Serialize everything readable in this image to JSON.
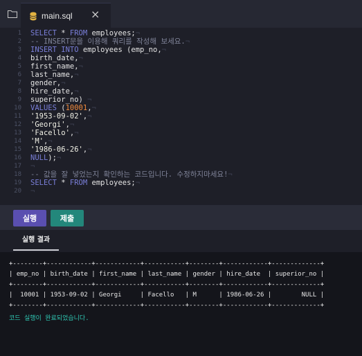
{
  "tab": {
    "filename": "main.sql",
    "close_glyph": "×"
  },
  "icons": {
    "folder": "folder-icon",
    "file": "database-icon",
    "close": "close-icon"
  },
  "editor": {
    "line_numbers": [
      "1",
      "2",
      "3",
      "4",
      "5",
      "6",
      "7",
      "8",
      "9",
      "10",
      "11",
      "12",
      "13",
      "14",
      "15",
      "16",
      "17",
      "18",
      "19",
      "20"
    ],
    "lines": [
      [
        [
          "kw",
          "SELECT"
        ],
        [
          "t",
          " * "
        ],
        [
          "kw",
          "FROM"
        ],
        [
          "t",
          " employees;"
        ],
        [
          "ws",
          "¬"
        ]
      ],
      [
        [
          "cmt",
          "-- INSERT문을 이용해 쿼리를 작성해 보세요."
        ],
        [
          "ws",
          "¬"
        ]
      ],
      [
        [
          "kw",
          "INSERT INTO"
        ],
        [
          "t",
          " employees (emp_no,"
        ],
        [
          "ws",
          "¬"
        ]
      ],
      [
        [
          "t",
          "birth_date,"
        ],
        [
          "ws",
          "¬"
        ]
      ],
      [
        [
          "t",
          "first_name,"
        ],
        [
          "ws",
          "¬"
        ]
      ],
      [
        [
          "t",
          "last_name,"
        ],
        [
          "ws",
          "¬"
        ]
      ],
      [
        [
          "t",
          "gender,"
        ],
        [
          "ws",
          "¬"
        ]
      ],
      [
        [
          "t",
          "hire_date,"
        ],
        [
          "ws",
          "¬"
        ]
      ],
      [
        [
          "t",
          "superior_no)"
        ],
        [
          "ws",
          " ¬"
        ]
      ],
      [
        [
          "kw",
          "VALUES"
        ],
        [
          "t",
          " ("
        ],
        [
          "num",
          "10001"
        ],
        [
          "t",
          ","
        ],
        [
          "ws",
          "¬"
        ]
      ],
      [
        [
          "str",
          "'1953-09-02'"
        ],
        [
          "t",
          ","
        ],
        [
          "ws",
          "¬"
        ]
      ],
      [
        [
          "str",
          "'Georgi'"
        ],
        [
          "t",
          ","
        ],
        [
          "ws",
          "¬"
        ]
      ],
      [
        [
          "str",
          "'Facello'"
        ],
        [
          "t",
          ","
        ],
        [
          "ws",
          "¬"
        ]
      ],
      [
        [
          "str",
          "'M'"
        ],
        [
          "t",
          ","
        ],
        [
          "ws",
          "¬"
        ]
      ],
      [
        [
          "str",
          "'1986-06-26'"
        ],
        [
          "t",
          ","
        ],
        [
          "ws",
          "¬"
        ]
      ],
      [
        [
          "kw",
          "NULL"
        ],
        [
          "t",
          ");"
        ],
        [
          "ws",
          "¬"
        ]
      ],
      [
        [
          "ws",
          "¬"
        ]
      ],
      [
        [
          "cmt",
          "-- 값을 잘 넣었는지 확인하는 코드입니다. 수정하지마세요!"
        ],
        [
          "ws",
          "¬"
        ]
      ],
      [
        [
          "kw",
          "SELECT"
        ],
        [
          "t",
          " * "
        ],
        [
          "kw",
          "FROM"
        ],
        [
          "t",
          " employees;"
        ],
        [
          "ws",
          "¬"
        ]
      ],
      [
        [
          "ws",
          "¬"
        ]
      ]
    ]
  },
  "buttons": {
    "run": "실행",
    "submit": "제출"
  },
  "result_tab": "실행 결과",
  "console": {
    "separator": "+--------+------------+------------+-----------+--------+------------+-------------+",
    "header": "| emp_no | birth_date | first_name | last_name | gender | hire_date  | superior_no |",
    "row": "|  10001 | 1953-09-02 | Georgi     | Facello   | M      | 1986-06-26 |        NULL |",
    "status": "코드 실행이 완료되었습니다."
  },
  "colors": {
    "background": "#1e1f28",
    "keyword": "#7a7fd9",
    "number": "#f08a3c",
    "comment": "#7f8398",
    "run_button": "#5a4fb0",
    "submit_button": "#23877b",
    "status_text": "#2fc8b4"
  }
}
